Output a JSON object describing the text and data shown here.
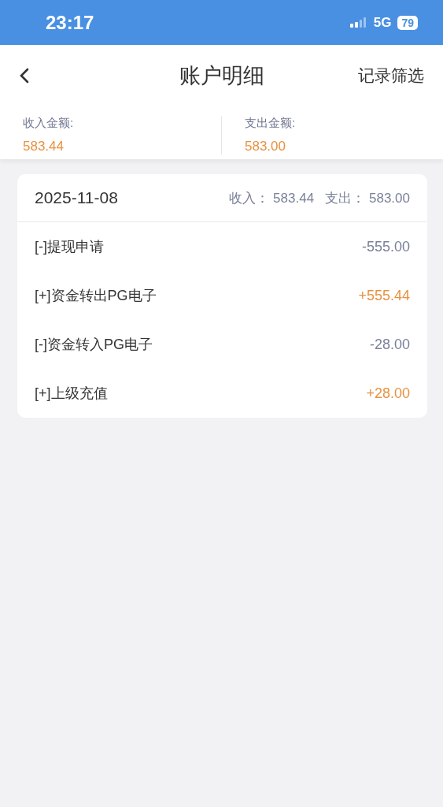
{
  "status_bar": {
    "time": "23:17",
    "network": "5G",
    "battery": "79"
  },
  "header": {
    "title": "账户明细",
    "action": "记录筛选"
  },
  "summary": [
    {
      "label": "收入金额:",
      "value": "583.44"
    },
    {
      "label": "支出金额:",
      "value": "583.00"
    }
  ],
  "day": {
    "date": "2025-11-08",
    "income_label": "收入：",
    "income": "583.44",
    "expense_label": "支出：",
    "expense": "583.00",
    "rows": [
      {
        "title": "[-]提现申请",
        "amount": "-555.00",
        "kind": "expense"
      },
      {
        "title": "[+]资金转出PG电子",
        "amount": "+555.44",
        "kind": "income"
      },
      {
        "title": "[-]资金转入PG电子",
        "amount": "-28.00",
        "kind": "expense"
      },
      {
        "title": "[+]上级充值",
        "amount": "+28.00",
        "kind": "income"
      }
    ]
  }
}
